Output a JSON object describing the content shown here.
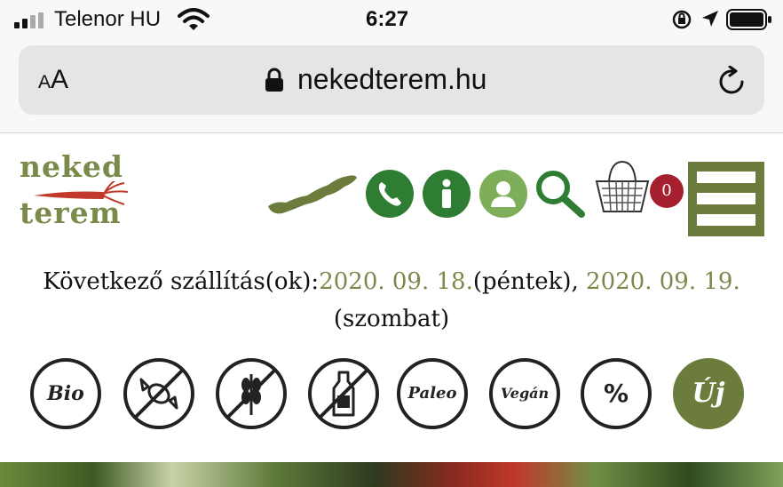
{
  "status_bar": {
    "carrier": "Telenor HU",
    "time": "6:27",
    "icons": [
      "signal-icon",
      "wifi-icon",
      "rotation-lock-icon",
      "location-icon",
      "battery-icon"
    ]
  },
  "browser": {
    "text_size_button": "AA",
    "url": "nekedterem.hu",
    "icons": [
      "padlock-icon",
      "reload-icon"
    ]
  },
  "site": {
    "logo": {
      "line1": "neked",
      "line2": "terem"
    },
    "header_icons": [
      "hungary-map-icon",
      "phone-icon",
      "info-icon",
      "user-icon",
      "search-icon",
      "basket-icon",
      "menu-icon"
    ],
    "cart_count": "0",
    "delivery": {
      "label": "Következő szállítás(ok):",
      "date1": "2020. 09. 18.",
      "day1": "(péntek)",
      "separator": ", ",
      "date2": "2020. 09. 19.",
      "day2": "(szombat)"
    },
    "filters": [
      {
        "label": "Bio"
      },
      {
        "label": ""
      },
      {
        "label": ""
      },
      {
        "label": ""
      },
      {
        "label": "Paleo"
      },
      {
        "label": "Vegán"
      },
      {
        "label": "%"
      },
      {
        "label": "Új"
      }
    ],
    "colors": {
      "brand_green": "#6b7c3c",
      "icon_green": "#2e7d32",
      "badge_red": "#a51f2e",
      "date_green": "#7a8a4a"
    }
  }
}
